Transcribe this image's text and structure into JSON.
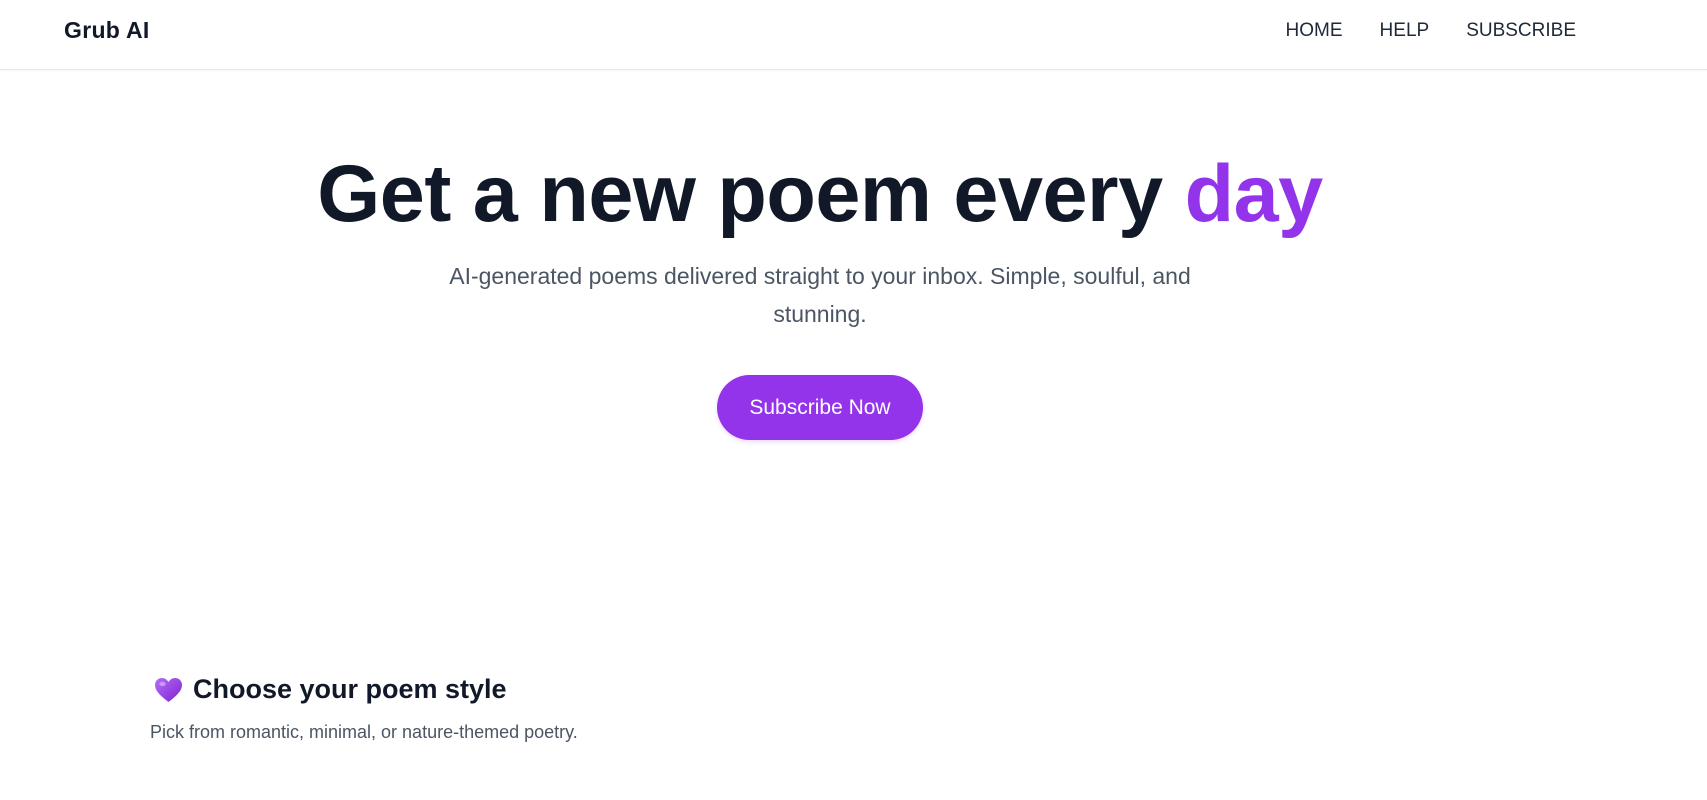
{
  "header": {
    "brand": "Grub AI",
    "nav": [
      {
        "label": "HOME"
      },
      {
        "label": "HELP"
      },
      {
        "label": "SUBSCRIBE"
      }
    ]
  },
  "hero": {
    "title_main": "Get a new poem every ",
    "title_accent": "day",
    "subtitle": "AI-generated poems delivered straight to your inbox. Simple, soulful, and stunning.",
    "cta_label": "Subscribe Now"
  },
  "feature": {
    "icon": "purple-heart-icon",
    "title": "Choose your poem style",
    "description": "Pick from romantic, minimal, or nature-themed poetry."
  },
  "colors": {
    "accent": "#9333ea",
    "text_dark": "#111827",
    "text_muted": "#4b5563"
  }
}
